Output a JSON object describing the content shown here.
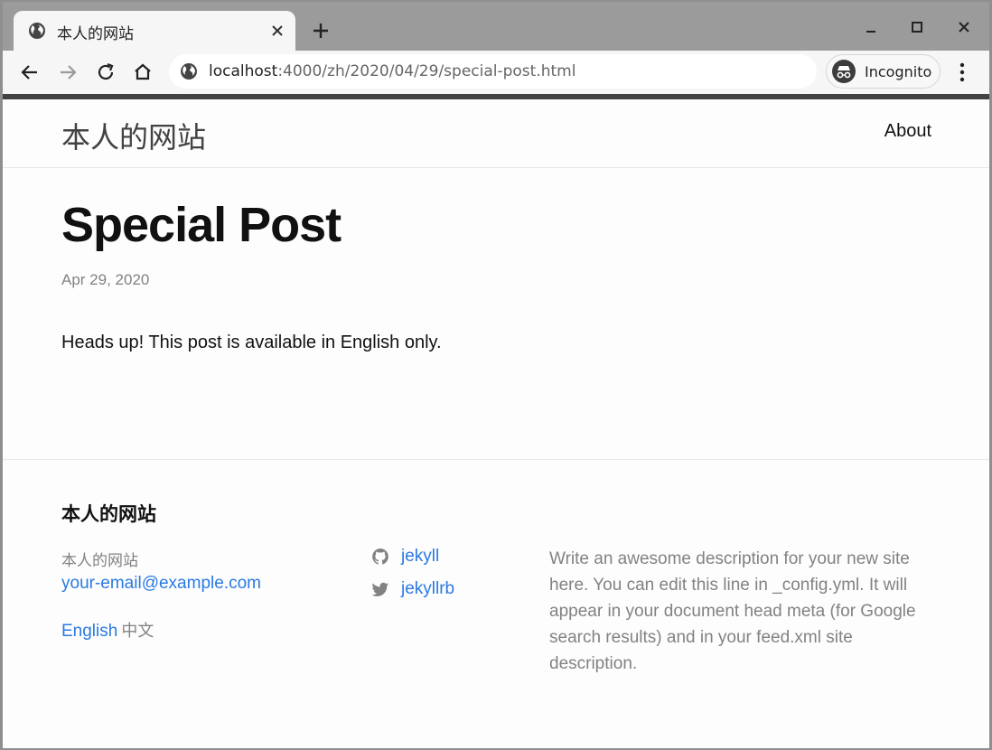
{
  "browser": {
    "tab": {
      "title": "本人的网站",
      "favicon": "globe-icon",
      "close_icon": "close-icon"
    },
    "new_tab_icon": "plus-icon",
    "window_controls": [
      "minimize-icon",
      "maximize-icon",
      "close-icon"
    ],
    "toolbar": {
      "back_icon": "arrow-left-icon",
      "forward_icon": "arrow-right-icon",
      "reload_icon": "reload-icon",
      "home_icon": "home-icon",
      "url_host": "localhost",
      "url_rest": ":4000/zh/2020/04/29/special-post.html",
      "incognito_label": "Incognito",
      "menu_icon": "kebab-menu-icon"
    }
  },
  "site": {
    "title": "本人的网站",
    "nav": {
      "about": "About"
    }
  },
  "post": {
    "title": "Special Post",
    "date": "Apr 29, 2020",
    "body": "Heads up! This post is available in English only."
  },
  "footer": {
    "heading": "本人的网站",
    "name": "本人的网站",
    "email": "your-email@example.com",
    "languages": {
      "english": "English",
      "chinese": "中文"
    },
    "social": [
      {
        "icon": "github-icon",
        "label": "jekyll"
      },
      {
        "icon": "twitter-icon",
        "label": "jekyllrb"
      }
    ],
    "description": "Write an awesome description for your new site here. You can edit this line in _config.yml. It will appear in your document head meta (for Google search results) and in your feed.xml site description."
  },
  "colors": {
    "link": "#2a7ae2",
    "muted_text": "#828282",
    "chrome_frame": "#9b9b9b",
    "toolbar": "#f6f6f6"
  }
}
